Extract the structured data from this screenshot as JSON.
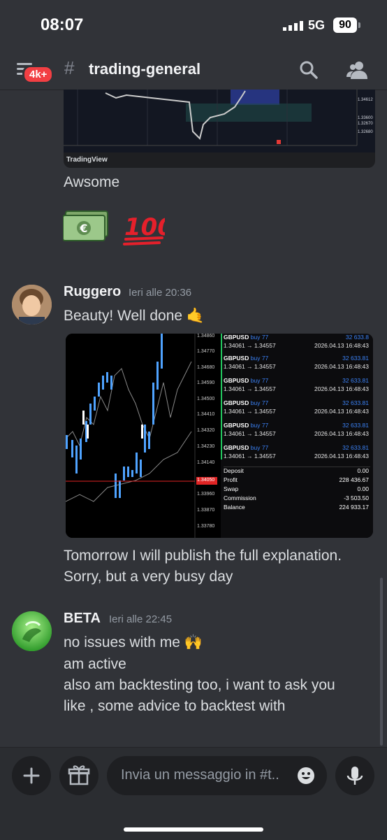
{
  "status": {
    "time": "08:07",
    "network": "5G",
    "battery": "90"
  },
  "header": {
    "badge": "4k+",
    "channel": "trading-general"
  },
  "embed": {
    "provider": "TradingView",
    "prices": [
      "1.34612",
      "1.33600",
      "1.32670",
      "1.32680"
    ]
  },
  "messages": [
    {
      "text": "Awsome"
    },
    {
      "author": "Ruggero",
      "time": "Ieri alle 20:36",
      "lines": [
        "Beauty! Well done 🤙"
      ]
    },
    {
      "lines": [
        "Tomorrow I will publish the full explanation.",
        "Sorry, but a very busy day"
      ]
    },
    {
      "author": "BETA",
      "time": "Ieri alle 22:45",
      "lines": [
        "no issues with me 🙌",
        "am active",
        "also am backtesting too, i want to ask you",
        "like , some advice to backtest with"
      ]
    }
  ],
  "attachment": {
    "price_levels": [
      "1.34860",
      "1.34770",
      "1.34680",
      "1.34590",
      "1.34500",
      "1.34410",
      "1.34320",
      "1.34230",
      "1.34140",
      "1.34050",
      "1.33960",
      "1.33870",
      "1.33780"
    ],
    "trades": [
      {
        "symbol": "GBPUSD",
        "direction": "buy 77",
        "pnl": "32 633.8",
        "prices": "1.34061 → 1.34557",
        "date": "2026.04.13 16:48:43"
      },
      {
        "symbol": "GBPUSD",
        "direction": "buy 77",
        "pnl": "32 633.81",
        "prices": "1.34061 → 1.34557",
        "date": "2026.04.13 16:48:43"
      },
      {
        "symbol": "GBPUSD",
        "direction": "buy 77",
        "pnl": "32 633.81",
        "prices": "1.34061 → 1.34557",
        "date": "2026.04.13 16:48:43"
      },
      {
        "symbol": "GBPUSD",
        "direction": "buy 77",
        "pnl": "32 633.81",
        "prices": "1.34061 → 1.34557",
        "date": "2026.04.13 16:48:43"
      },
      {
        "symbol": "GBPUSD",
        "direction": "buy 77",
        "pnl": "32 633.81",
        "prices": "1.34061 → 1.34557",
        "date": "2026.04.13 16:48:43"
      },
      {
        "symbol": "GBPUSD",
        "direction": "buy 77",
        "pnl": "32 633.81",
        "prices": "1.34061 → 1.34557",
        "date": "2026.04.13 16:48:43"
      }
    ],
    "summary": [
      {
        "label": "Deposit",
        "value": "0.00"
      },
      {
        "label": "Profit",
        "value": "228 436.67"
      },
      {
        "label": "Swap",
        "value": "0.00"
      },
      {
        "label": "Commission",
        "value": "-3 503.50"
      },
      {
        "label": "Balance",
        "value": "224 933.17"
      }
    ]
  },
  "composer": {
    "placeholder": "Invia un messaggio in #t.."
  },
  "colors": {
    "background": "#313338",
    "accent_red": "#f23f43",
    "link_blue": "#3b82f6"
  }
}
